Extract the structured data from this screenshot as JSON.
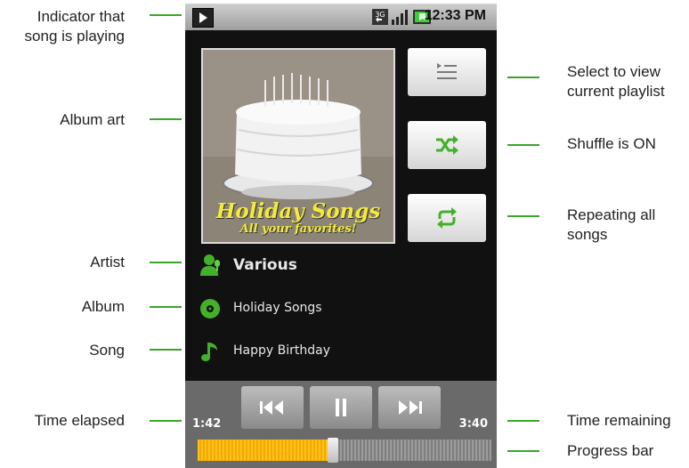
{
  "callouts": {
    "playing_indicator": [
      "Indicator that",
      "song is playing"
    ],
    "album_art": "Album art",
    "artist": "Artist",
    "album": "Album",
    "song": "Song",
    "time_elapsed": "Time elapsed",
    "playlist": [
      "Select to view",
      "current playlist"
    ],
    "shuffle": "Shuffle is ON",
    "repeat": [
      "Repeating all",
      "songs"
    ],
    "time_remaining": "Time remaining",
    "progress_bar": "Progress bar"
  },
  "status_bar": {
    "time": "12:33 PM",
    "network_label": "3G",
    "icons": [
      "play-indicator-icon",
      "3g-icon",
      "signal-icon",
      "battery-charging-icon"
    ]
  },
  "album_art": {
    "title": "Holiday Songs",
    "subtitle": "All your favorites!"
  },
  "now_playing": {
    "artist": "Various",
    "album": "Holiday Songs",
    "song": "Happy Birthday"
  },
  "controls": {
    "icons": [
      "previous-icon",
      "pause-icon",
      "next-icon",
      "playlist-icon",
      "shuffle-icon",
      "repeat-icon"
    ],
    "shuffle_on": true,
    "repeat_all": true
  },
  "time": {
    "elapsed": "1:42",
    "remaining": "3:40"
  },
  "progress": {
    "fraction": 0.46
  },
  "colors": {
    "accent_green": "#3aa629",
    "progress_fill": "#f3a900",
    "art_text": "#f4ea3c"
  }
}
